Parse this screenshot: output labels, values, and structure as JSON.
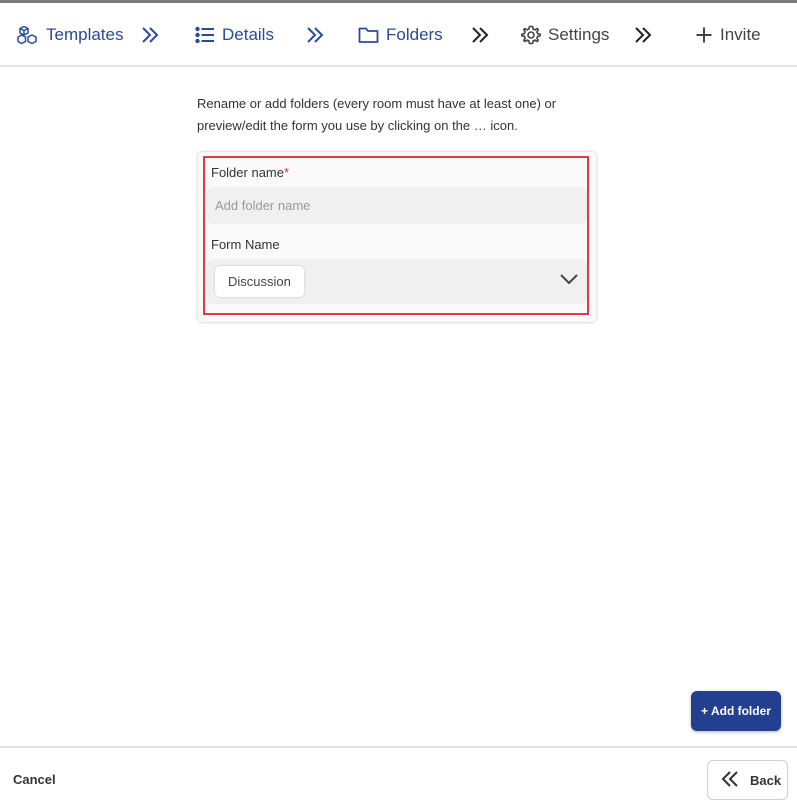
{
  "stepper": {
    "steps": [
      {
        "label": "Templates",
        "icon": "cubes-icon",
        "state": "done"
      },
      {
        "label": "Details",
        "icon": "list-icon",
        "state": "done"
      },
      {
        "label": "Folders",
        "icon": "folder-icon",
        "state": "current"
      },
      {
        "label": "Settings",
        "icon": "gear-icon",
        "state": "todo"
      },
      {
        "label": "Invite",
        "icon": "plus-icon",
        "state": "todo"
      }
    ],
    "separator_icon": "double-chevron-right-icon"
  },
  "instructions": "Rename or add folders (every room must have at least one) or preview/edit the form you use by clicking on the … icon.",
  "folder_card": {
    "folder_name_label": "Folder name",
    "required_marker": "*",
    "folder_name_placeholder": "Add folder name",
    "folder_name_value": "",
    "form_name_label": "Form Name",
    "form_name_selected": "Discussion"
  },
  "buttons": {
    "add_folder": "+ Add folder",
    "cancel": "Cancel",
    "back": "Back"
  },
  "colors": {
    "accent": "#233f8f",
    "completed_step": "#2a4a9a",
    "highlight": "#e33b45"
  }
}
